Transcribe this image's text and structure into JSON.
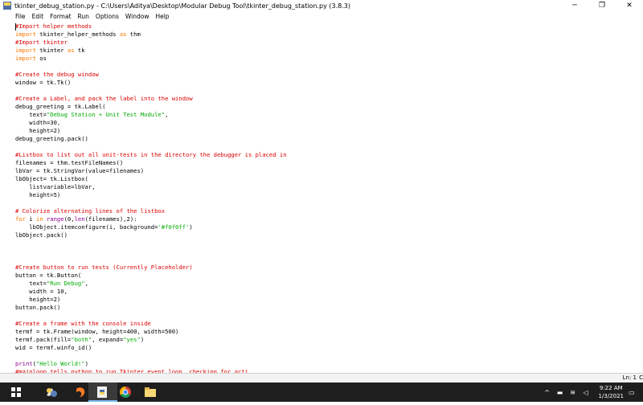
{
  "window": {
    "title": "tkinter_debug_station.py - C:\\Users\\Aditya\\Desktop\\Modular Debug Tool\\tkinter_debug_station.py (3.8.3)",
    "controls": {
      "minimize": "─",
      "maximize": "❐",
      "close": "✕"
    }
  },
  "menu": [
    "File",
    "Edit",
    "Format",
    "Run",
    "Options",
    "Window",
    "Help"
  ],
  "code_lines": [
    [
      [
        "comment",
        "#Import helper methods"
      ]
    ],
    [
      [
        "keyword",
        "import"
      ],
      [
        "plain",
        " tkinter_helper_methods "
      ],
      [
        "keyword",
        "as"
      ],
      [
        "plain",
        " thm"
      ]
    ],
    [
      [
        "comment",
        "#Import tkinter"
      ]
    ],
    [
      [
        "keyword",
        "import"
      ],
      [
        "plain",
        " tkinter "
      ],
      [
        "keyword",
        "as"
      ],
      [
        "plain",
        " tk"
      ]
    ],
    [
      [
        "keyword",
        "import"
      ],
      [
        "plain",
        " os"
      ]
    ],
    [],
    [
      [
        "comment",
        "#Create the debug window"
      ]
    ],
    [
      [
        "plain",
        "window = tk.Tk()"
      ]
    ],
    [],
    [
      [
        "comment",
        "#Create a Label, and pack the label into the window"
      ]
    ],
    [
      [
        "plain",
        "debug_greeting = tk.Label("
      ]
    ],
    [
      [
        "plain",
        "    text="
      ],
      [
        "string",
        "\"Debug Station + Unit Test Module\""
      ],
      [
        "plain",
        ","
      ]
    ],
    [
      [
        "plain",
        "    width=30,"
      ]
    ],
    [
      [
        "plain",
        "    height=2)"
      ]
    ],
    [
      [
        "plain",
        "debug_greeting.pack()"
      ]
    ],
    [],
    [
      [
        "comment",
        "#Listbox to list out all unit-tests in the directory the debugger is placed in"
      ]
    ],
    [
      [
        "plain",
        "filenames = thm.testFileNames()"
      ]
    ],
    [
      [
        "plain",
        "lbVar = tk.StringVar(value=filenames)"
      ]
    ],
    [
      [
        "plain",
        "lbObject= tk.Listbox("
      ]
    ],
    [
      [
        "plain",
        "    listvariable=lbVar,"
      ]
    ],
    [
      [
        "plain",
        "    height=5)"
      ]
    ],
    [],
    [
      [
        "comment",
        "# Colorize alternating lines of the listbox"
      ]
    ],
    [
      [
        "keyword",
        "for"
      ],
      [
        "plain",
        " i "
      ],
      [
        "keyword",
        "in"
      ],
      [
        "plain",
        " "
      ],
      [
        "builtin",
        "range"
      ],
      [
        "plain",
        "(0,"
      ],
      [
        "builtin",
        "len"
      ],
      [
        "plain",
        "(filenames),2):"
      ]
    ],
    [
      [
        "plain",
        "    lbObject.itemconfigure(i, background="
      ],
      [
        "string",
        "'#f0f0ff'"
      ],
      [
        "plain",
        ")"
      ]
    ],
    [
      [
        "plain",
        "lbObject.pack()"
      ]
    ],
    [],
    [],
    [],
    [
      [
        "comment",
        "#Create button to run tests (Currently Placeholder)"
      ]
    ],
    [
      [
        "plain",
        "button = tk.Button("
      ]
    ],
    [
      [
        "plain",
        "    text="
      ],
      [
        "string",
        "\"Run Debug\""
      ],
      [
        "plain",
        ","
      ]
    ],
    [
      [
        "plain",
        "    width = 10,"
      ]
    ],
    [
      [
        "plain",
        "    height=2)"
      ]
    ],
    [
      [
        "plain",
        "button.pack()"
      ]
    ],
    [],
    [
      [
        "comment",
        "#Create a frame with the console inside"
      ]
    ],
    [
      [
        "plain",
        "termf = tk.Frame(window, height=400, width=500)"
      ]
    ],
    [
      [
        "plain",
        "termf.pack(fill="
      ],
      [
        "string",
        "\"both\""
      ],
      [
        "plain",
        ", expand="
      ],
      [
        "string",
        "\"yes\""
      ],
      [
        "plain",
        ")"
      ]
    ],
    [
      [
        "plain",
        "wid = termf.winfo_id()"
      ]
    ],
    [],
    [
      [
        "builtin",
        "print"
      ],
      [
        "plain",
        "("
      ],
      [
        "string",
        "\"Hello World!\""
      ],
      [
        "plain",
        ")"
      ]
    ],
    [
      [
        "comment",
        "#mainloop tells python to run Tkinter event loop, checking for acti"
      ]
    ]
  ],
  "status": {
    "position": "Ln: 1",
    "col": "C"
  },
  "colors": {
    "comment": "#dd0000",
    "keyword": "#ff7700",
    "builtin": "#900090",
    "string": "#00aa00",
    "taskbar": "#1e1e1e"
  },
  "taskbar": {
    "apps": [
      "python-idle-icon",
      "firefox-icon",
      "brackets-icon",
      "python-file-icon",
      "chrome-icon",
      "file-explorer-icon"
    ],
    "tray": {
      "time": "9:22 AM",
      "date": "1/3/2021"
    }
  }
}
